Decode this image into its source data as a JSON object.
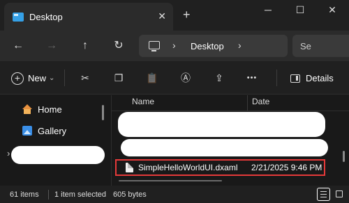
{
  "window": {
    "tab_title": "Desktop",
    "tab_close_glyph": "✕",
    "new_tab_glyph": "+",
    "minimize_glyph": "─",
    "maximize_glyph": "☐",
    "close_glyph": "✕"
  },
  "nav": {
    "back_glyph": "←",
    "forward_glyph": "→",
    "up_glyph": "↑",
    "refresh_glyph": "↻",
    "address_segments": [
      "Desktop"
    ],
    "chevron_glyph": "›",
    "search_placeholder": "Se"
  },
  "toolbar": {
    "new_label": "New",
    "new_plus": "+",
    "new_chevron": "⌄",
    "cut_glyph": "✂",
    "copy_glyph": "❐",
    "paste_glyph": "📋",
    "rename_glyph": "Ⓐ",
    "share_glyph": "⇪",
    "more_glyph": "•••",
    "details_label": "Details"
  },
  "sidebar": {
    "items": [
      {
        "label": "Home",
        "icon": "home-icon"
      },
      {
        "label": "Gallery",
        "icon": "gallery-icon"
      }
    ],
    "collapsed_glyph": "›"
  },
  "filelist": {
    "columns": [
      "Name",
      "Date"
    ],
    "selected_file": {
      "name": "SimpleHelloWorldUI.dxaml",
      "date": "2/21/2025 9:46 PM"
    }
  },
  "status": {
    "item_count": "61 items",
    "selection": "1 item selected",
    "size": "605 bytes"
  },
  "colors": {
    "highlight_border": "#e63a3a",
    "accent": "#35a0e6"
  }
}
